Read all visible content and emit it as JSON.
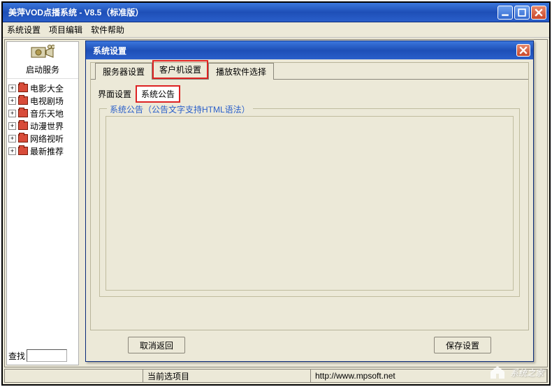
{
  "window": {
    "title": "美萍VOD点播系统 - V8.5（标准版）"
  },
  "menu": {
    "items": [
      "系统设置",
      "项目编辑",
      "软件帮助"
    ]
  },
  "sidebar": {
    "start_service_label": "启动服务",
    "tree": [
      "电影大全",
      "电视剧场",
      "音乐天地",
      "动漫世界",
      "网络视听",
      "最新推荐"
    ],
    "search_label": "查找"
  },
  "statusbar": {
    "current_item_label": "当前选项目",
    "url": "http://www.mpsoft.net"
  },
  "dialog": {
    "title": "系统设置",
    "tabs": {
      "server": "服务器设置",
      "client": "客户机设置",
      "player": "播放软件选择"
    },
    "subtabs": {
      "ui_label": "界面设置",
      "announcement": "系统公告"
    },
    "fieldset_legend": "系统公告（公告文字支持HTML语法）",
    "buttons": {
      "cancel": "取消返回",
      "save": "保存设置"
    }
  },
  "watermark": "系统之家"
}
